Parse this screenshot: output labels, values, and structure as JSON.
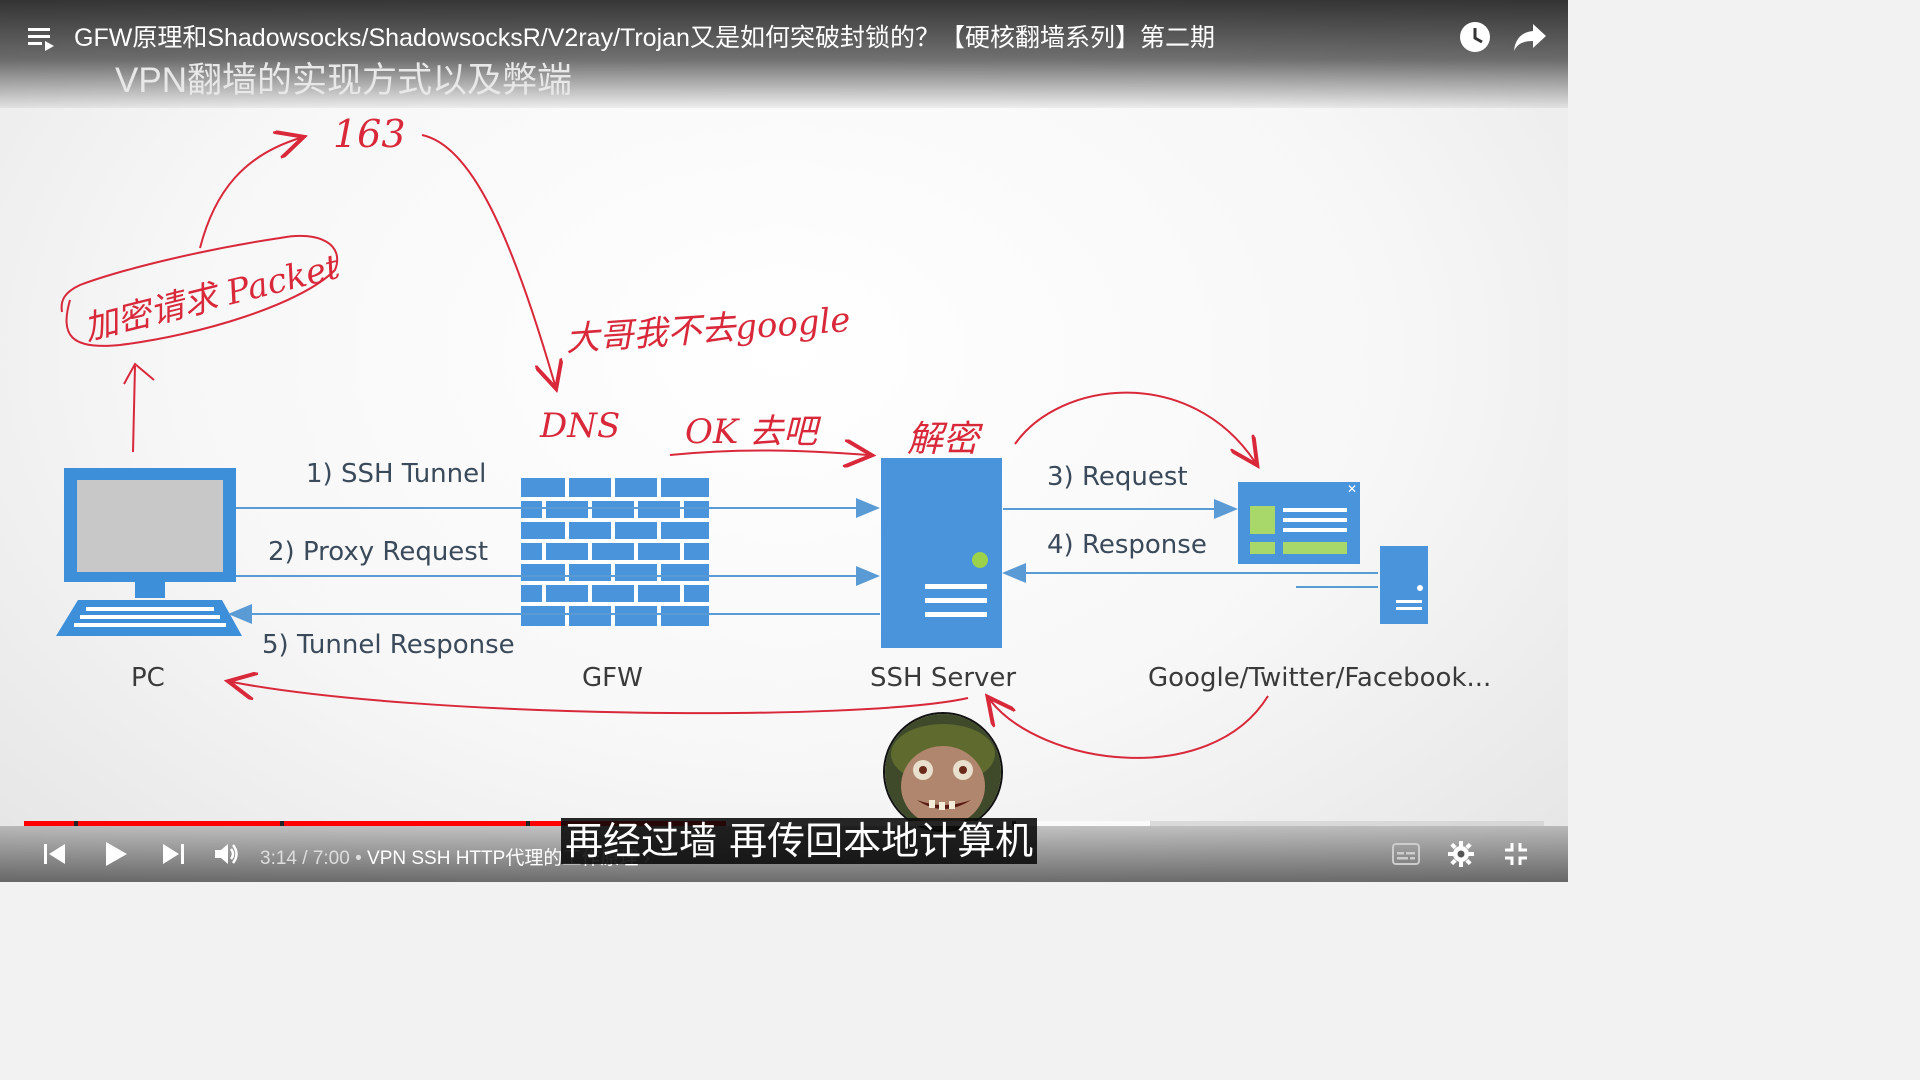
{
  "video": {
    "title": "GFW原理和Shadowsocks/ShadowsocksR/V2ray/Trojan又是如何突破封锁的？【硬核翻墙系列】第二期"
  },
  "slide": {
    "title": "VPN翻墙的实现方式以及弊端",
    "node_labels": {
      "pc": "PC",
      "gfw": "GFW",
      "ssh_server": "SSH Server",
      "sites": "Google/Twitter/Facebook..."
    },
    "arrow_labels": {
      "ssh_tunnel": "1) SSH Tunnel",
      "proxy_request": "2) Proxy Request",
      "request": "3) Request",
      "response": "4) Response",
      "tunnel_response": "5) Tunnel Response"
    },
    "annotations": {
      "encrypted_packet": "加密请求 Packet",
      "site_163": "163",
      "not_google": "大哥我不去google",
      "dns": "DNS",
      "ok_go": "OK 去吧",
      "decrypt": "解密"
    }
  },
  "player": {
    "time_display": "3:14 / 7:00",
    "separator": "•",
    "chapter": "VPN SSH HTTP代理的工作原理",
    "chapter_arrow": "›",
    "progress_fraction": 0.4619,
    "subtitle": "再经过墙 再传回本地计算机"
  },
  "colors": {
    "accent_red": "#ff0000",
    "diagram_blue": "#3d8fd9",
    "annotation_red": "#d8283a"
  }
}
